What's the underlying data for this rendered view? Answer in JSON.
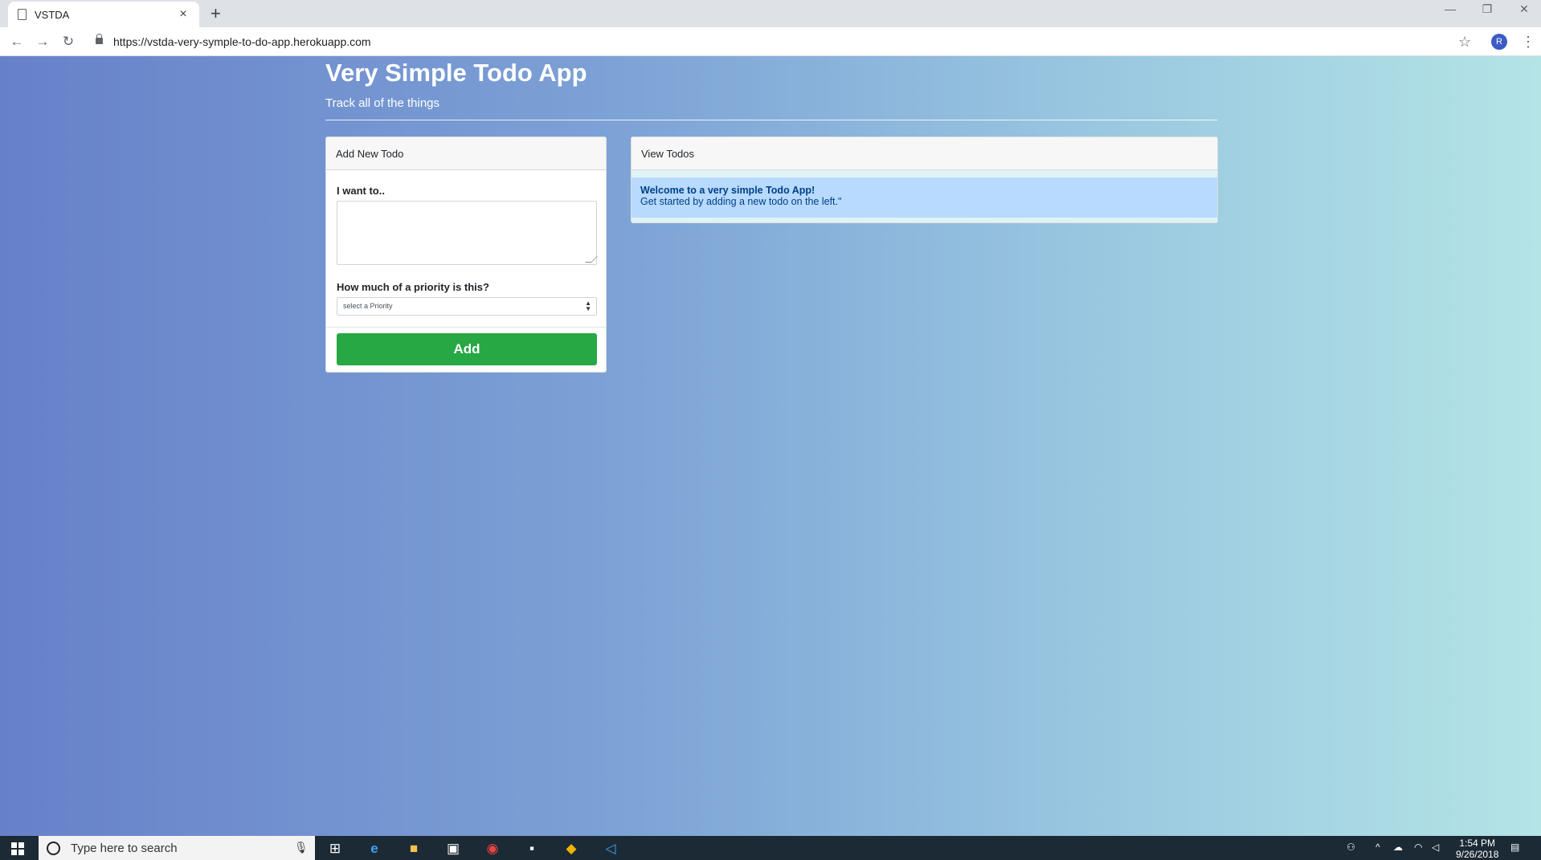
{
  "browser": {
    "tab_title": "VSTDA",
    "tab_close": "×",
    "new_tab": "+",
    "url": "https://vstda-very-symple-to-do-app.herokuapp.com",
    "avatar_letter": "R",
    "controls": {
      "back": "←",
      "forward": "→",
      "reload": "↻",
      "star": "☆",
      "menu": "⋮",
      "minimize": "—",
      "restore": "❐",
      "close": "✕"
    }
  },
  "header": {
    "title": "Very Simple Todo App",
    "subtitle": "Track all of the things"
  },
  "add_panel": {
    "header": "Add New Todo",
    "todo_label": "I want to..",
    "priority_label": "How much of a priority is this?",
    "priority_selected": "select a Priority",
    "add_button": "Add"
  },
  "view_panel": {
    "header": "View Todos",
    "welcome_title": "Welcome to a very simple Todo App!",
    "welcome_text": "Get started by adding a new todo on the left.\""
  },
  "taskbar": {
    "search_placeholder": "Type here to search",
    "time": "1:54 PM",
    "date": "9/26/2018"
  },
  "colors": {
    "add_button": "#28a745",
    "welcome_bg": "#b8daff",
    "welcome_text": "#004085",
    "taskbar": "#1c2a35"
  }
}
